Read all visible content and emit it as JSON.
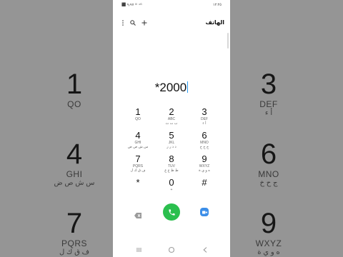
{
  "status": {
    "left": "⬛ ٩٫٩٧ ᴵˡˡ ⁴ᴳ",
    "time": "١٢:٢٥"
  },
  "header": {
    "title": "الهاتف"
  },
  "icons": {
    "more": "more-icon",
    "search": "search-icon",
    "add": "add-icon"
  },
  "dial": {
    "number": "*2000"
  },
  "keys": [
    {
      "d": "1",
      "l": "QO",
      "a": ""
    },
    {
      "d": "2",
      "l": "ABC",
      "a": "ب ت ث"
    },
    {
      "d": "3",
      "l": "DEF",
      "a": "أ ء"
    },
    {
      "d": "4",
      "l": "GHI",
      "a": "س ش ص ض"
    },
    {
      "d": "5",
      "l": "JKL",
      "a": "د ذ ر ز"
    },
    {
      "d": "6",
      "l": "MNO",
      "a": "ج ح خ"
    },
    {
      "d": "7",
      "l": "PQRS",
      "a": "ف ق ك ل"
    },
    {
      "d": "8",
      "l": "TUV",
      "a": "ط ظ ع غ"
    },
    {
      "d": "9",
      "l": "WXYZ",
      "a": "ه و ي ة"
    },
    {
      "d": "*",
      "l": "",
      "a": ""
    },
    {
      "d": "0",
      "l": "+",
      "a": ""
    },
    {
      "d": "#",
      "l": "",
      "a": ""
    }
  ],
  "background": {
    "left": [
      {
        "d": "1",
        "l": "QO",
        "a": ""
      },
      {
        "d": "4",
        "l": "GHI",
        "a": "س ش ص ض"
      },
      {
        "d": "7",
        "l": "PQRS",
        "a": "ف ق ك ل"
      }
    ],
    "right": [
      {
        "d": "3",
        "l": "DEF",
        "a": "أ ء"
      },
      {
        "d": "6",
        "l": "MNO",
        "a": "ج ح خ"
      },
      {
        "d": "9",
        "l": "WXYZ",
        "a": "ه و ي ة"
      }
    ]
  },
  "colors": {
    "call": "#2bbf4e",
    "video": "#3c8ee8",
    "cursor": "#2a9df4"
  }
}
